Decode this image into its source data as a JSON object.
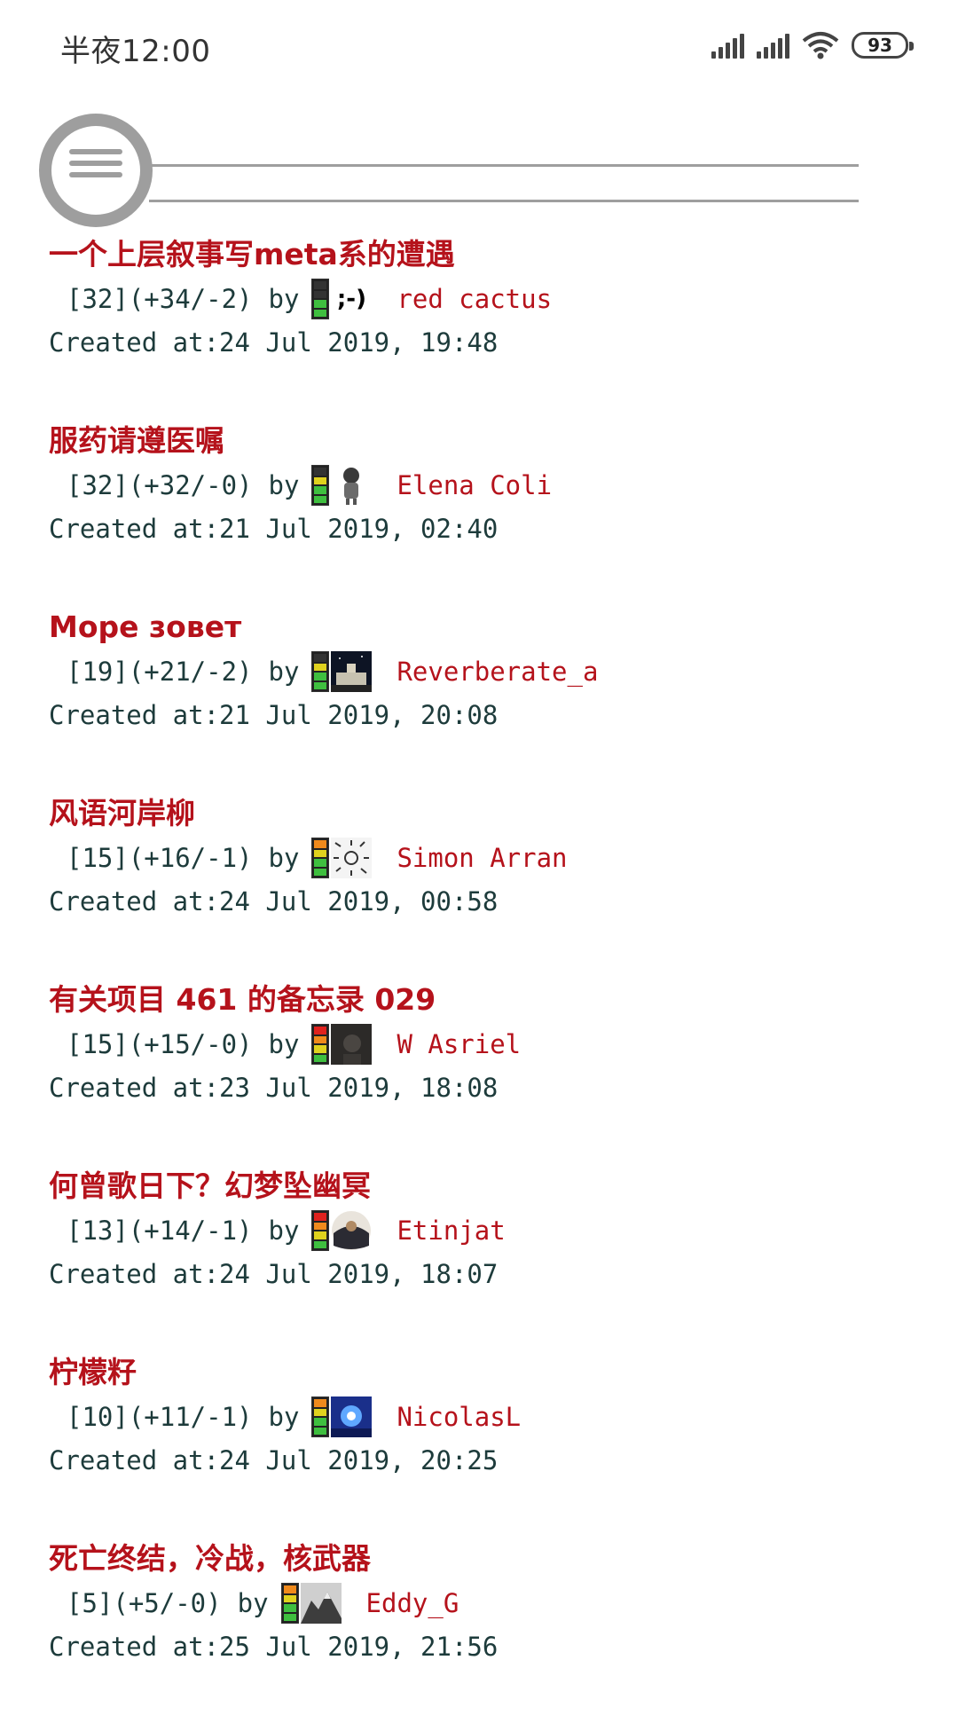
{
  "status_bar": {
    "time": "半夜12:00",
    "battery": "93",
    "icons": [
      "signal-icon",
      "signal-icon",
      "wifi-icon",
      "battery-icon"
    ]
  },
  "header": {
    "menu_icon": "menu-icon"
  },
  "articles": [
    {
      "title": "一个上层叙事写meta系的遭遇",
      "stats": "[32](+34/-2)",
      "by": "by",
      "author": "red cactus",
      "created": "Created at:24 Jul 2019, 19:48",
      "rating_icon": "rating-bar-icon",
      "avatar_text": ";-)"
    },
    {
      "title": "服药请遵医嘱",
      "stats": "[32](+32/-0)",
      "by": "by",
      "author": "Elena Coli",
      "created": "Created at:21 Jul 2019, 02:40",
      "rating_icon": "rating-bar-icon",
      "avatar_text": ""
    },
    {
      "title": "Море зовет",
      "stats": "[19](+21/-2)",
      "by": "by",
      "author": "Reverberate_a",
      "created": "Created at:21 Jul 2019, 20:08",
      "rating_icon": "rating-bar-icon",
      "avatar_text": ""
    },
    {
      "title": "风语河岸柳",
      "stats": "[15](+16/-1)",
      "by": "by",
      "author": "Simon Arran",
      "created": "Created at:24 Jul 2019, 00:58",
      "rating_icon": "rating-bar-icon",
      "avatar_text": ""
    },
    {
      "title": "有关项目 461 的备忘录 029",
      "stats": "[15](+15/-0)",
      "by": "by",
      "author": "W Asriel",
      "created": "Created at:23 Jul 2019, 18:08",
      "rating_icon": "rating-bar-icon",
      "avatar_text": ""
    },
    {
      "title": "何曾歌日下？幻梦坠幽冥",
      "stats": "[13](+14/-1)",
      "by": "by",
      "author": "Etinjat",
      "created": "Created at:24 Jul 2019, 18:07",
      "rating_icon": "rating-bar-icon",
      "avatar_text": ""
    },
    {
      "title": "柠檬籽",
      "stats": "[10](+11/-1)",
      "by": "by",
      "author": "NicolasL",
      "created": "Created at:24 Jul 2019, 20:25",
      "rating_icon": "rating-bar-icon",
      "avatar_text": ""
    },
    {
      "title": "死亡终结，冷战，核武器",
      "stats": "[5](+5/-0)",
      "by": "by",
      "author": "Eddy_G",
      "created": "Created at:25 Jul 2019, 21:56",
      "rating_icon": "rating-bar-icon",
      "avatar_text": ""
    }
  ]
}
